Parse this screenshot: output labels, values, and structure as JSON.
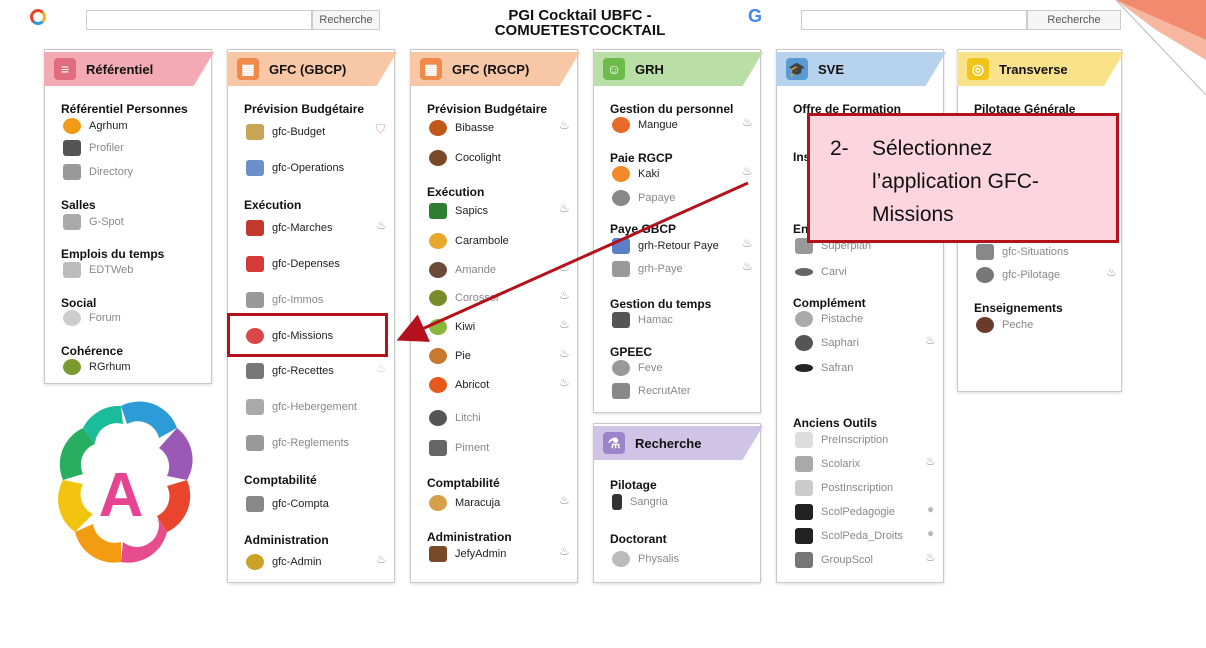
{
  "header": {
    "title_line1": "PGI Cocktail UBFC -",
    "title_line2": "COMUETESTCOCKTAIL",
    "search_left_button": "Recherche",
    "search_right_button": "Recherche"
  },
  "cards": {
    "referentiel": {
      "title": "Référentiel",
      "s1": "Référentiel Personnes",
      "agrhum": "Agrhum",
      "profiler": "Profiler",
      "directory": "Directory",
      "s2": "Salles",
      "gspot": "G-Spot",
      "s3": "Emplois du temps",
      "edtweb": "EDTWeb",
      "s4": "Social",
      "forum": "Forum",
      "s5": "Cohérence",
      "rgrhum": "RGrhum"
    },
    "gbcp": {
      "title": "GFC (GBCP)",
      "s1": "Prévision Budgétaire",
      "budget": "gfc-Budget",
      "operations": "gfc-Operations",
      "s2": "Exécution",
      "marches": "gfc-Marches",
      "depenses": "gfc-Depenses",
      "immos": "gfc-Immos",
      "missions": "gfc-Missions",
      "recettes": "gfc-Recettes",
      "hebergement": "gfc-Hebergement",
      "reglements": "gfc-Reglements",
      "s3": "Comptabilité",
      "compta": "gfc-Compta",
      "s4": "Administration",
      "admin": "gfc-Admin"
    },
    "rgcp": {
      "title": "GFC (RGCP)",
      "s1": "Prévision Budgétaire",
      "bibasse": "Bibasse",
      "cocolight": "Cocolight",
      "s2": "Exécution",
      "sapics": "Sapics",
      "carambole": "Carambole",
      "amande": "Amande",
      "corossol": "Corossol",
      "kiwi": "Kiwi",
      "pie": "Pie",
      "abricot": "Abricot",
      "litchi": "Litchi",
      "piment": "Piment",
      "s3": "Comptabilité",
      "maracuja": "Maracuja",
      "s4": "Administration",
      "jefyadmin": "JefyAdmin"
    },
    "grh": {
      "title": "GRH",
      "s1": "Gestion du personnel",
      "mangue": "Mangue",
      "s2": "Paie RGCP",
      "kaki": "Kaki",
      "papaye": "Papaye",
      "s3": "Paye GBCP",
      "retour": "grh-Retour Paye",
      "paye": "grh-Paye",
      "s4": "Gestion du temps",
      "hamac": "Hamac",
      "s5": "GPEEC",
      "feve": "Feve",
      "recrutater": "RecrutAter"
    },
    "recherche": {
      "title": "Recherche",
      "s1": "Pilotage",
      "sangria": "Sangria",
      "s2": "Doctorant",
      "physalis": "Physalis"
    },
    "sve": {
      "title": "SVE",
      "s1": "Offre de Formation",
      "s2": "Ins",
      "s3": "En",
      "superplan": "Superplan",
      "carvi": "Carvi",
      "s4": "Complément",
      "pistache": "Pistache",
      "saphari": "Saphari",
      "safran": "Safran",
      "s5": "Anciens Outils",
      "preinscription": "PreInscription",
      "scolarix": "Scolarix",
      "postinscription": "PostInscription",
      "scolpedagogie": "ScolPedagogie",
      "scolpeda_droits": "ScolPeda_Droits",
      "groupscol": "GroupScol"
    },
    "transverse": {
      "title": "Transverse",
      "s1": "Pilotage Générale",
      "situations": "gfc-Situations",
      "pilotage": "gfc-Pilotage",
      "s2": "Enseignements",
      "peche": "Peche"
    }
  },
  "callout": {
    "number": "2-",
    "line1": "Sélectionnez",
    "line2": "l’application GFC-",
    "line3": "Missions"
  },
  "colors": {
    "referentiel": "#f4aab4",
    "gbcp": "#f8c8a6",
    "rgcp": "#f8c8a6",
    "grh": "#b9dfa6",
    "recherche": "#cfc3e6",
    "sve": "#b7d2ec",
    "transverse": "#f9e28a",
    "annotation": "#b3121d"
  }
}
